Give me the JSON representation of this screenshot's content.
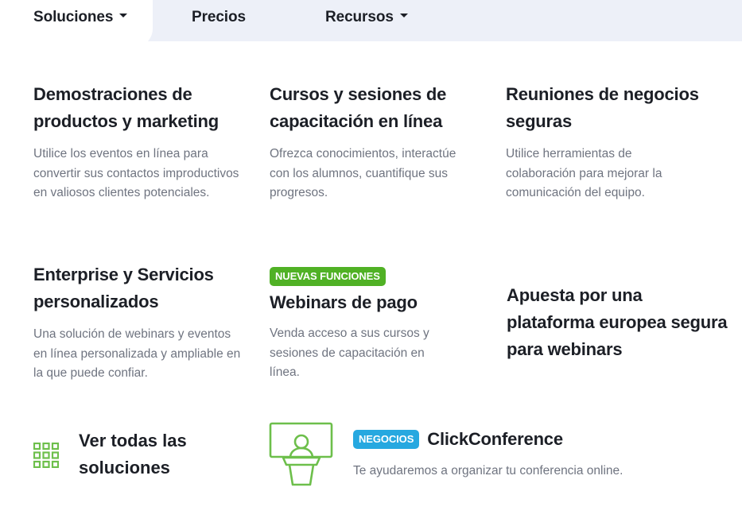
{
  "nav": {
    "items": [
      {
        "label": "Soluciones"
      },
      {
        "label": "Precios"
      },
      {
        "label": "Recursos"
      }
    ]
  },
  "cards": [
    {
      "title": "Demostraciones de productos y marketing",
      "desc": "Utilice los eventos en línea para convertir sus contactos improductivos en valiosos clientes potenciales."
    },
    {
      "title": "Cursos y sesiones de capacitación en línea",
      "desc": "Ofrezca conocimientos, interactúe con los alumnos, cuantifique sus progresos."
    },
    {
      "title": "Reuniones de negocios seguras",
      "desc": "Utilice herramientas de colaboración para mejorar la comunicación del equipo."
    },
    {
      "title": "Enterprise y Servicios personalizados",
      "desc": "Una solución de webinars y eventos en línea personalizada y ampliable en la que puede confiar."
    },
    {
      "badge": "NUEVAS FUNCIONES",
      "title": "Webinars de pago",
      "desc": "Venda acceso a sus cursos y sesiones de capacitación en línea."
    }
  ],
  "euro_text": "Apuesta por una plataforma europea segura para webinars",
  "all_solutions": {
    "label": "Ver todas las soluciones",
    "icon": "grid-icon"
  },
  "conference": {
    "badge": "NEGOCIOS",
    "title": "ClickConference",
    "desc": "Te ayudaremos a organizar tu conferencia online.",
    "icon": "presenter-icon"
  },
  "colors": {
    "accent_green": "#50b125",
    "accent_blue": "#26a8e0",
    "nav_bg": "#edf0f8",
    "icon_green": "#6dbf4b"
  }
}
